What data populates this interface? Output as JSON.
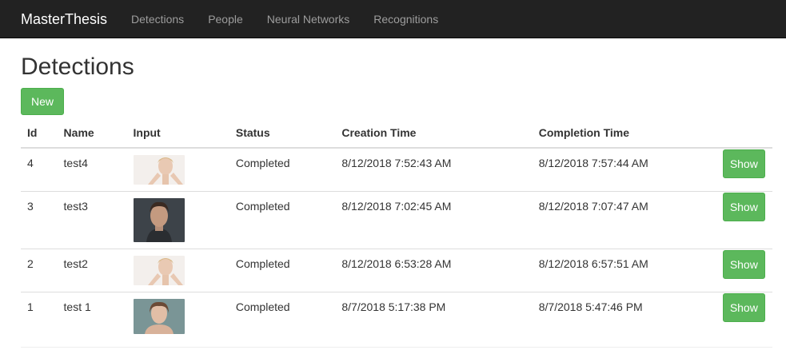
{
  "navbar": {
    "brand": "MasterThesis",
    "links": [
      "Detections",
      "People",
      "Neural Networks",
      "Recognitions"
    ]
  },
  "page": {
    "title": "Detections",
    "new_button": "New"
  },
  "table": {
    "headers": [
      "Id",
      "Name",
      "Input",
      "Status",
      "Creation Time",
      "Completion Time"
    ],
    "rows": [
      {
        "id": "4",
        "name": "test4",
        "status": "Completed",
        "created": "8/12/2018 7:52:43 AM",
        "completed": "8/12/2018 7:57:44 AM",
        "action": "Show"
      },
      {
        "id": "3",
        "name": "test3",
        "status": "Completed",
        "created": "8/12/2018 7:02:45 AM",
        "completed": "8/12/2018 7:07:47 AM",
        "action": "Show"
      },
      {
        "id": "2",
        "name": "test2",
        "status": "Completed",
        "created": "8/12/2018 6:53:28 AM",
        "completed": "8/12/2018 6:57:51 AM",
        "action": "Show"
      },
      {
        "id": "1",
        "name": "test 1",
        "status": "Completed",
        "created": "8/7/2018 5:17:38 PM",
        "completed": "8/7/2018 5:47:46 PM",
        "action": "Show"
      }
    ]
  },
  "colors": {
    "navbar_bg": "#222222",
    "success_green": "#5cb85c"
  }
}
